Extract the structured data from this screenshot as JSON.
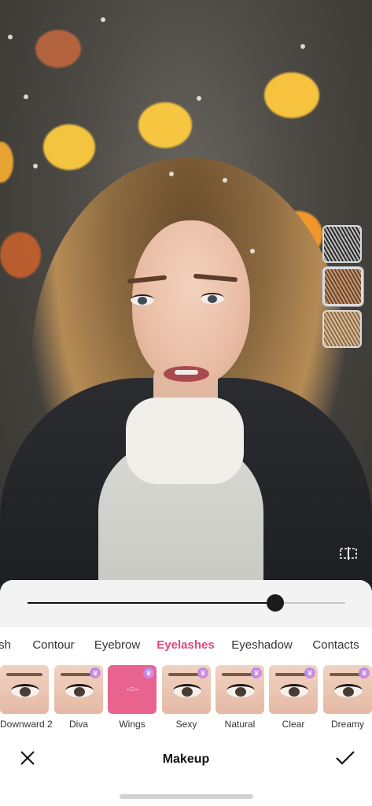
{
  "app": {
    "screen_title": "Makeup"
  },
  "colors": {
    "accent": "#e54580",
    "panel_bg": "#ffffff",
    "slider_track": "#c7c7c7",
    "slider_fill": "#111111"
  },
  "slider": {
    "value_fraction": 0.78
  },
  "category_tabs": [
    {
      "label": "sh",
      "active": false
    },
    {
      "label": "Contour",
      "active": false
    },
    {
      "label": "Eyebrow",
      "active": false
    },
    {
      "label": "Eyelashes",
      "active": true
    },
    {
      "label": "Eyeshadow",
      "active": false
    },
    {
      "label": "Contacts",
      "active": false
    }
  ],
  "looks": [
    {
      "label": "Downward 2",
      "premium": false,
      "selected": false
    },
    {
      "label": "Diva",
      "premium": true,
      "selected": false
    },
    {
      "label": "Wings",
      "premium": true,
      "selected": true
    },
    {
      "label": "Sexy",
      "premium": true,
      "selected": false
    },
    {
      "label": "Natural",
      "premium": true,
      "selected": false
    },
    {
      "label": "Clear",
      "premium": true,
      "selected": false
    },
    {
      "label": "Dreamy",
      "premium": true,
      "selected": false
    }
  ],
  "swatches": [
    {
      "name": "black-lash-swatch",
      "color": "#3a3a3a",
      "selected": false
    },
    {
      "name": "brown-lash-swatch",
      "color": "#7b5236",
      "selected": true
    },
    {
      "name": "light-brown-lash-swatch",
      "color": "#9c7a54",
      "selected": false
    }
  ],
  "icons": {
    "close": "close-icon",
    "confirm": "checkmark-icon",
    "compare": "compare-icon",
    "premium_badge": "crown-badge-icon"
  }
}
